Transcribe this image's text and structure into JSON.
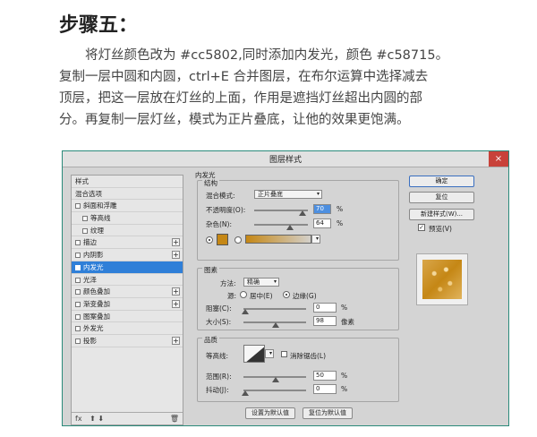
{
  "tutorial": {
    "title": "步骤五：",
    "lines": [
      "　　将灯丝颜色改为 #cc5802,同时添加内发光，颜色 #c58715。",
      "复制一层中圆和内圆，ctrl+E 合并图层，在布尔运算中选择减去",
      "顶层，把这一层放在灯丝的上面，作用是遮挡灯丝超出内圆的部",
      "分。再复制一层灯丝，模式为正片叠底，让他的效果更饱满。"
    ]
  },
  "dialog": {
    "title": "图层样式",
    "close": "×",
    "styles_list": {
      "header": "样式",
      "items": [
        {
          "label": "混合选项",
          "checkbox": false,
          "plus": false,
          "indent": false,
          "selected": false
        },
        {
          "label": "斜面和浮雕",
          "checkbox": true,
          "plus": false,
          "indent": false,
          "selected": false
        },
        {
          "label": "等高线",
          "checkbox": true,
          "plus": false,
          "indent": true,
          "selected": false
        },
        {
          "label": "纹理",
          "checkbox": true,
          "plus": false,
          "indent": true,
          "selected": false
        },
        {
          "label": "描边",
          "checkbox": true,
          "plus": true,
          "indent": false,
          "selected": false
        },
        {
          "label": "内阴影",
          "checkbox": true,
          "plus": true,
          "indent": false,
          "selected": false
        },
        {
          "label": "内发光",
          "checkbox": true,
          "plus": false,
          "indent": false,
          "selected": true
        },
        {
          "label": "光泽",
          "checkbox": true,
          "plus": false,
          "indent": false,
          "selected": false
        },
        {
          "label": "颜色叠加",
          "checkbox": true,
          "plus": true,
          "indent": false,
          "selected": false
        },
        {
          "label": "渐变叠加",
          "checkbox": true,
          "plus": true,
          "indent": false,
          "selected": false
        },
        {
          "label": "图案叠加",
          "checkbox": true,
          "plus": false,
          "indent": false,
          "selected": false
        },
        {
          "label": "外发光",
          "checkbox": true,
          "plus": false,
          "indent": false,
          "selected": false
        },
        {
          "label": "投影",
          "checkbox": true,
          "plus": true,
          "indent": false,
          "selected": false
        }
      ],
      "footer_fx": "fx",
      "footer_arrows": "⬆ ⬇",
      "footer_trash": "🗑"
    },
    "inner_glow": {
      "section_title": "内发光",
      "structure": {
        "title": "结构",
        "blend_mode_label": "混合模式:",
        "blend_mode_value": "正片叠底",
        "opacity_label": "不透明度(O):",
        "opacity_value": "70",
        "opacity_unit": "%",
        "noise_label": "杂色(N):",
        "noise_value": "64",
        "noise_unit": "%",
        "glow_color": "#c58715"
      },
      "elements": {
        "title": "图素",
        "technique_label": "方法:",
        "technique_value": "精确",
        "source_label": "源:",
        "source_center": "居中(E)",
        "source_edge": "边缘(G)",
        "choke_label": "阻塞(C):",
        "choke_value": "0",
        "choke_unit": "%",
        "size_label": "大小(S):",
        "size_value": "98",
        "size_unit": "像素"
      },
      "quality": {
        "title": "品质",
        "contour_label": "等高线:",
        "antialias_label": "消除锯齿(L)",
        "range_label": "范围(R):",
        "range_value": "50",
        "range_unit": "%",
        "jitter_label": "抖动(J):",
        "jitter_value": "0",
        "jitter_unit": "%"
      },
      "make_default": "设置为默认值",
      "reset_default": "复位为默认值"
    },
    "buttons": {
      "ok": "确定",
      "reset": "复位",
      "new_style": "新建样式(W)...",
      "preview": "预览(V)"
    }
  }
}
